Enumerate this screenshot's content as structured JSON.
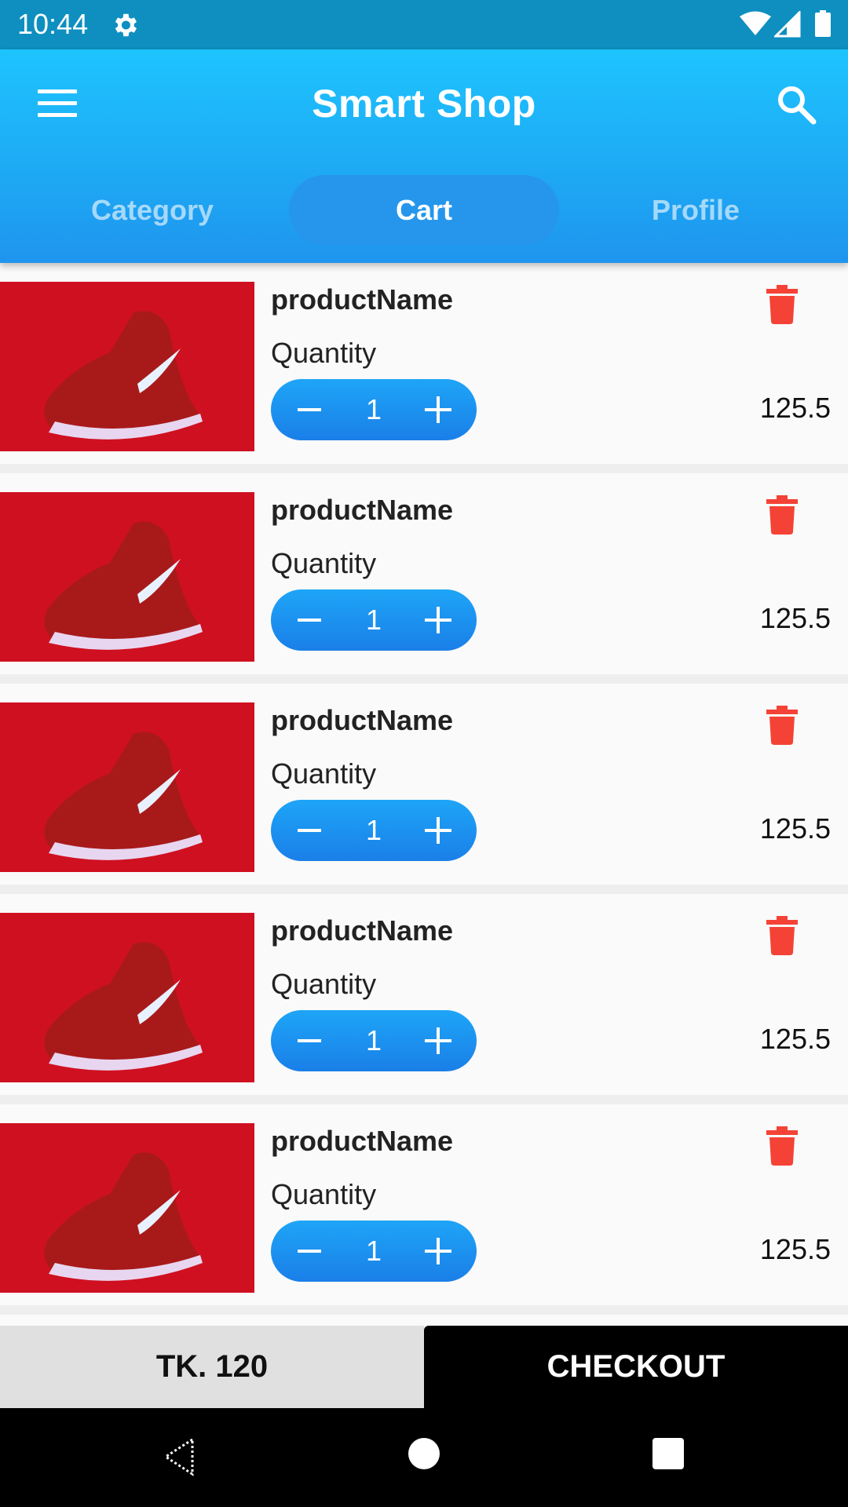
{
  "status_bar": {
    "time": "10:44"
  },
  "app_bar": {
    "title": "Smart Shop"
  },
  "tabs": [
    {
      "label": "Category",
      "active": false
    },
    {
      "label": "Cart",
      "active": true
    },
    {
      "label": "Profile",
      "active": false
    }
  ],
  "cart": {
    "items": [
      {
        "name": "productName",
        "quantity_label": "Quantity",
        "quantity": "1",
        "price": "125.5"
      },
      {
        "name": "productName",
        "quantity_label": "Quantity",
        "quantity": "1",
        "price": "125.5"
      },
      {
        "name": "productName",
        "quantity_label": "Quantity",
        "quantity": "1",
        "price": "125.5"
      },
      {
        "name": "productName",
        "quantity_label": "Quantity",
        "quantity": "1",
        "price": "125.5"
      },
      {
        "name": "productName",
        "quantity_label": "Quantity",
        "quantity": "1",
        "price": "125.5"
      }
    ]
  },
  "footer": {
    "total": "TK. 120",
    "checkout_label": "CHECKOUT"
  },
  "colors": {
    "app_bar": "#1ea8f4",
    "stepper": "#1a8cf0",
    "delete": "#f44336",
    "product_bg": "#cf1020"
  },
  "icons": [
    "gear-icon",
    "wifi-icon",
    "cell-signal-icon",
    "battery-icon",
    "menu-icon",
    "search-icon",
    "minus-icon",
    "plus-icon",
    "trash-icon",
    "back-icon",
    "home-icon",
    "recents-icon"
  ]
}
